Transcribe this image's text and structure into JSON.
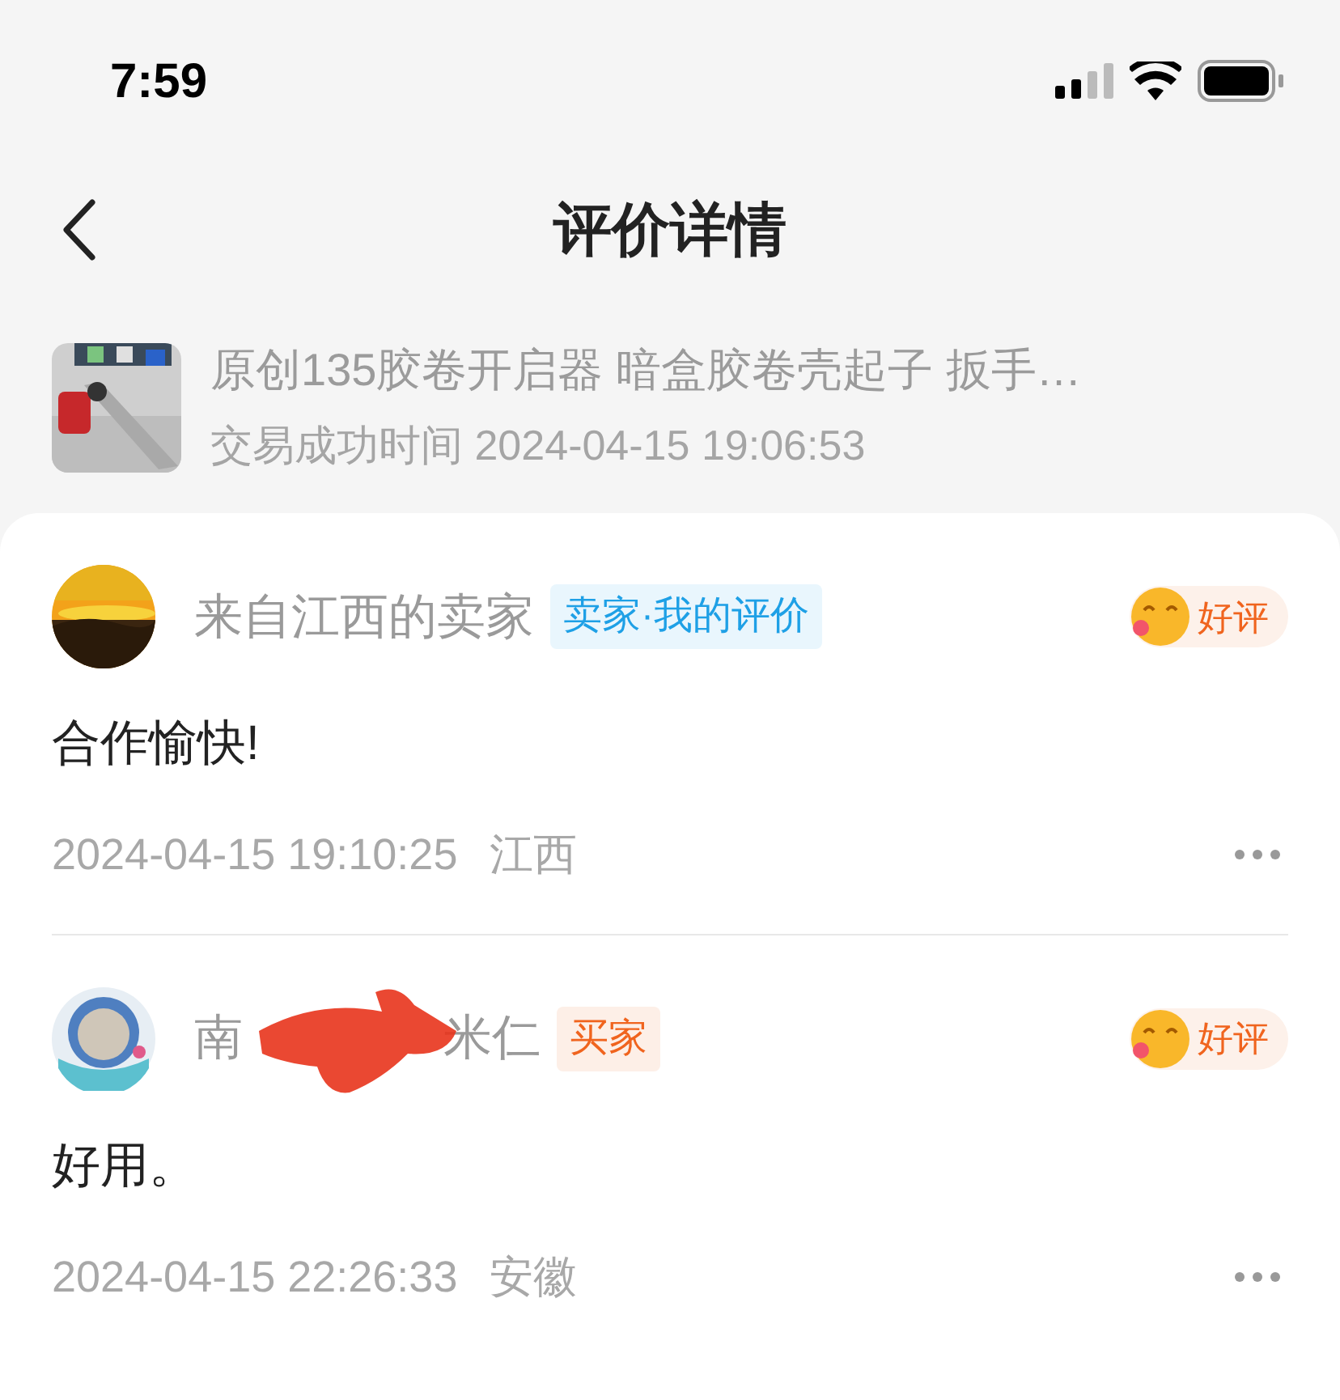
{
  "status_bar": {
    "time": "7:59"
  },
  "header": {
    "title": "评价详情"
  },
  "product": {
    "title": "原创135胶卷开启器 暗盒胶卷壳起子 扳手…",
    "trade_time": "交易成功时间 2024-04-15 19:06:53"
  },
  "reviews": [
    {
      "name": "来自江西的卖家",
      "redacted": false,
      "tag": {
        "kind": "seller",
        "label": "卖家·我的评价"
      },
      "rating": "好评",
      "text": "合作愉快!",
      "time": "2024-04-15 19:10:25",
      "region": "江西"
    },
    {
      "avatar": {
        "kind": "icon"
      },
      "name": "南",
      "name_tail": "米仁",
      "redacted": true,
      "tag": {
        "kind": "buyer",
        "label": "买家"
      },
      "rating": "好评",
      "text": "好用。",
      "time": "2024-04-15 22:26:33",
      "region": "安徽"
    }
  ]
}
